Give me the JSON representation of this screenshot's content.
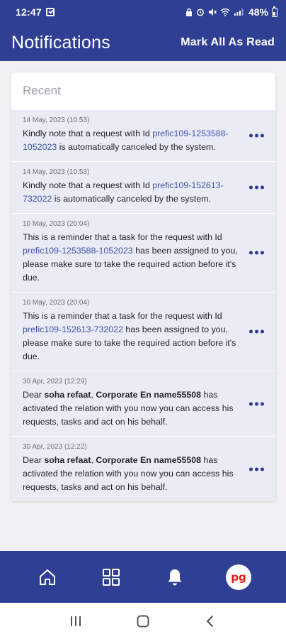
{
  "status_bar": {
    "time": "12:47",
    "battery": "48%",
    "icons": [
      "lock-icon",
      "alarm-icon",
      "mute-icon",
      "wifi-icon",
      "signal-icon",
      "battery-icon"
    ]
  },
  "header": {
    "title": "Notifications",
    "mark_all_label": "Mark All As Read"
  },
  "section": {
    "title": "Recent"
  },
  "notifications": [
    {
      "time": "14 May, 2023 (10:53)",
      "text_before": "Kindly note that a request with Id ",
      "request_id": "prefic109-1253588-1052023",
      "text_after": " is automatically canceled by the system."
    },
    {
      "time": "14 May, 2023 (10:53)",
      "text_before": "Kindly note that a request with Id ",
      "request_id": "prefic109-152613-732022",
      "text_after": " is automatically canceled by the system."
    },
    {
      "time": "10 May, 2023 (20:04)",
      "text_before": "This is a reminder that a task for the request with Id ",
      "request_id": "prefic109-1253588-1052023",
      "text_after": " has been assigned to you, please make sure to take the required action before it's due."
    },
    {
      "time": "10 May, 2023 (20:04)",
      "text_before": "This is a reminder that a task for the request with Id ",
      "request_id": "prefic109-152613-732022",
      "text_after": " has been assigned to you, please make sure to take the required action before it's due."
    },
    {
      "time": "30 Apr, 2023 (12:29)",
      "greeting": "Dear ",
      "user_name": "soha refaat",
      "separator": ", ",
      "company_name": "Corporate En name55508",
      "text_after": " has activated the relation with you now you can access his requests, tasks and act on his behalf."
    },
    {
      "time": "30 Apr, 2023 (12:22)",
      "greeting": "Dear ",
      "user_name": "soha refaat",
      "separator": ", ",
      "company_name": "Corporate En name55508",
      "text_after": " has activated the relation with you now you can access his requests, tasks and act on his behalf."
    }
  ],
  "bottom_nav": {
    "items": [
      "home-icon",
      "dashboard-icon",
      "bell-icon"
    ],
    "avatar_text": "pg"
  },
  "colors": {
    "primary": "#2f3f93",
    "item_bg": "#e9ebf5",
    "link": "#4052a8",
    "avatar_text": "#e21b1b"
  }
}
